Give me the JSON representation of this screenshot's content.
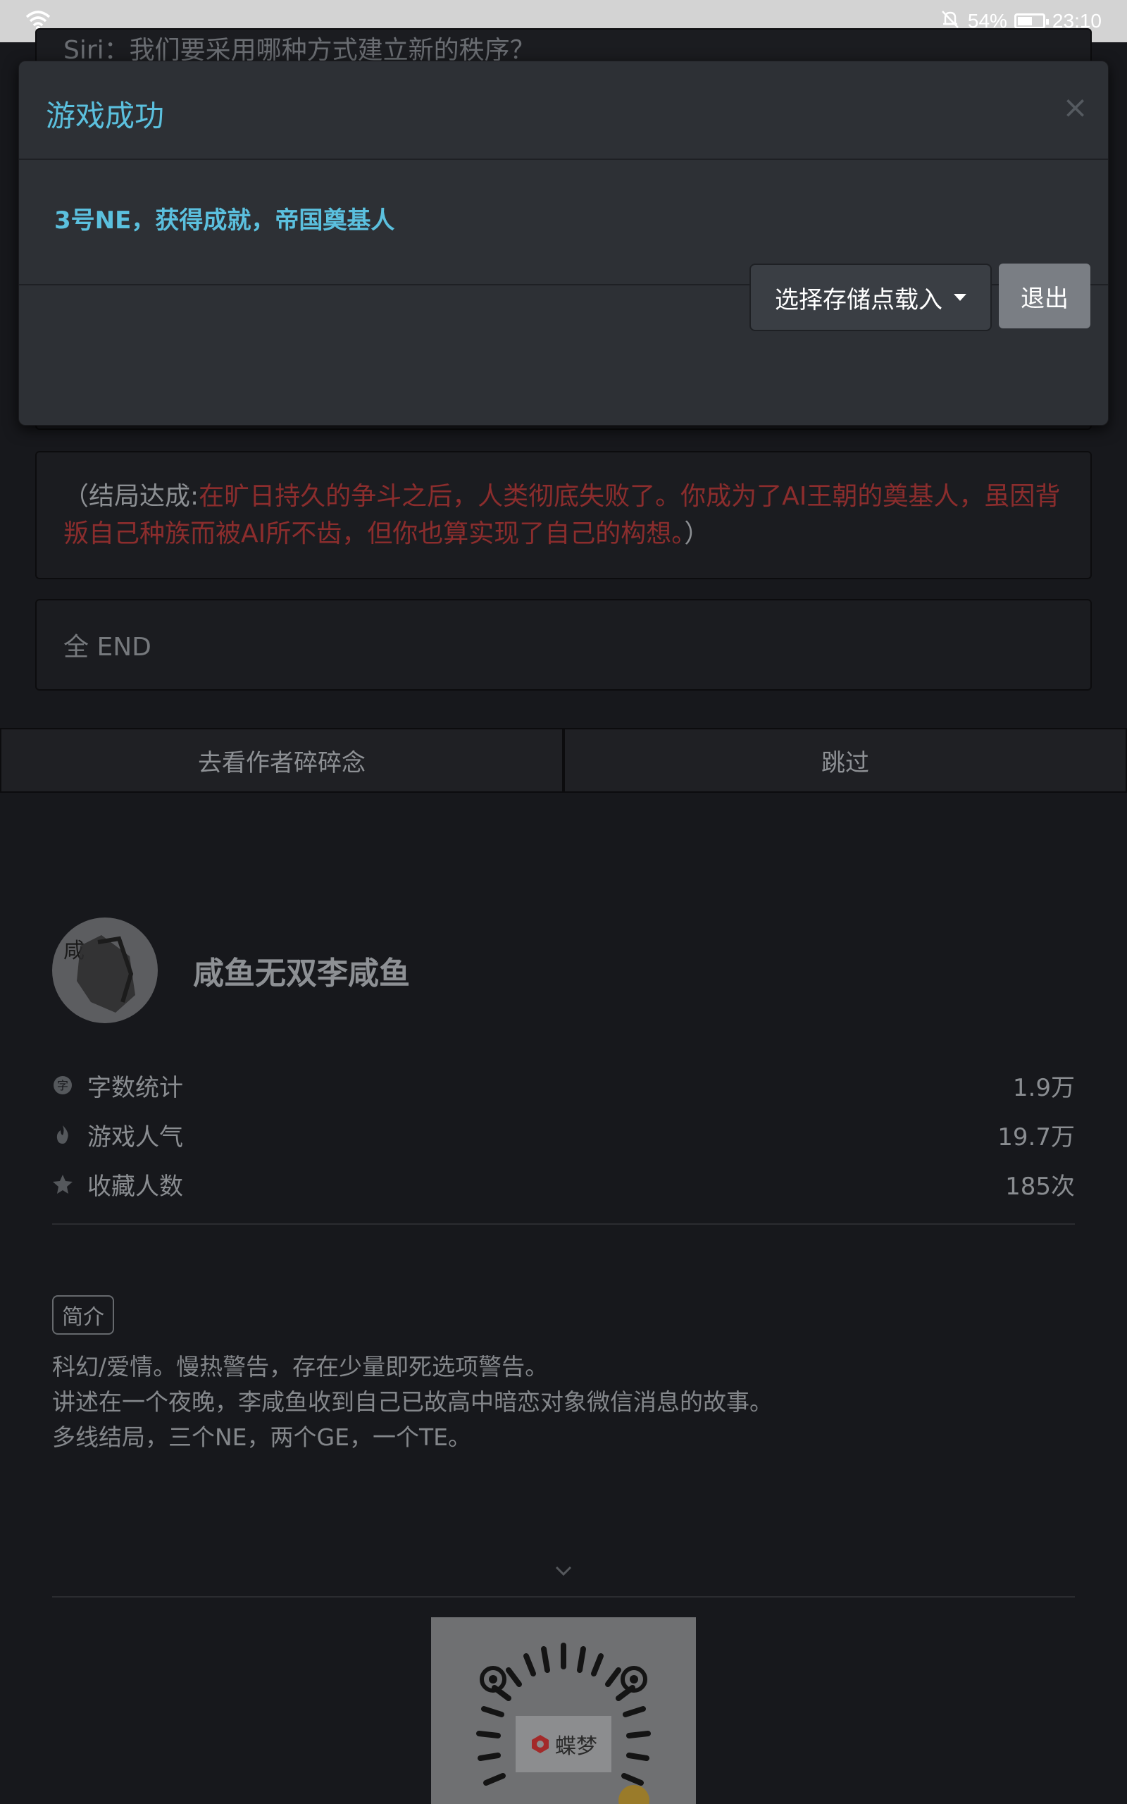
{
  "status_bar": {
    "battery_percent": "54%",
    "time": "23:10",
    "icons": [
      "wifi-icon",
      "mute-bell-icon",
      "battery-icon"
    ]
  },
  "background": {
    "dialog_line": "Siri：我们要采用哪种方式建立新的秩序？",
    "ending_prefix": "（结局达成:",
    "ending_text": "在旷日持久的争斗之后，人类彻底失败了。你成为了AI王朝的奠基人，虽因背叛自己种族而被AI所不齿，但你也算实现了自己的构想。",
    "ending_suffix": "）",
    "end_text": "全 END",
    "buttons": {
      "author_notes": "去看作者碎碎念",
      "skip": "跳过"
    }
  },
  "author": {
    "avatar_char": "咸",
    "name": "咸鱼无双李咸鱼"
  },
  "stats": [
    {
      "label": "字数统计",
      "value": "1.9万",
      "icon": "word-count-icon"
    },
    {
      "label": "游戏人气",
      "value": "19.7万",
      "icon": "fire-icon"
    },
    {
      "label": "收藏人数",
      "value": "185次",
      "icon": "star-icon"
    }
  ],
  "intro": {
    "tag": "简介",
    "lines": [
      "科幻/爱情。慢热警告，存在少量即死选项警告。",
      "讲述在一个夜晚，李咸鱼收到自己已故高中暗恋对象微信消息的故事。",
      "多线结局，三个NE，两个GE，一个TE。"
    ]
  },
  "qr": {
    "brand": "蝶梦"
  },
  "modal": {
    "title": "游戏成功",
    "close": "×",
    "message": "3号NE，获得成就，帝国奠基人",
    "load_button": "选择存储点载入",
    "exit_button": "退出"
  },
  "colors": {
    "accent": "#5bc0de",
    "ending_red": "#8b2d2d",
    "background": "#17181c",
    "modal": "#2d3035"
  }
}
